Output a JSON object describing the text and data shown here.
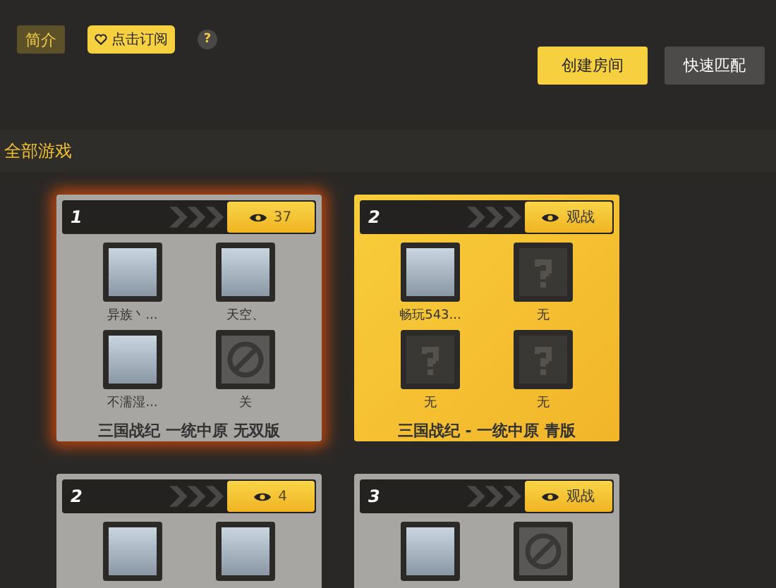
{
  "toolbar": {
    "intro_button": "简介",
    "subscribe_button": "点击订阅",
    "help_icon": "?",
    "create_room_button": "创建房间",
    "quick_match_button": "快速匹配"
  },
  "section_title": "全部游戏",
  "rooms": [
    {
      "number": "1",
      "kind": "gray",
      "selected": true,
      "watch": {
        "kind": "count",
        "label": "37"
      },
      "title": "三国战纪 一统中原 无双版",
      "slots": [
        {
          "kind": "player",
          "label": "异族丶..."
        },
        {
          "kind": "player",
          "label": "天空、"
        },
        {
          "kind": "player",
          "label": "不濡湿..."
        },
        {
          "kind": "closed",
          "label": "关"
        }
      ]
    },
    {
      "number": "2",
      "kind": "yellow",
      "selected": false,
      "watch": {
        "kind": "text",
        "label": "观战"
      },
      "title": "三国战纪 - 一统中原 青版",
      "slots": [
        {
          "kind": "player",
          "label": "畅玩543..."
        },
        {
          "kind": "empty",
          "label": "无"
        },
        {
          "kind": "empty",
          "label": "无"
        },
        {
          "kind": "empty",
          "label": "无"
        }
      ]
    },
    {
      "number": "2",
      "kind": "gray",
      "selected": false,
      "watch": {
        "kind": "count",
        "label": "4"
      },
      "slots": [
        {
          "kind": "player"
        },
        {
          "kind": "player"
        }
      ]
    },
    {
      "number": "3",
      "kind": "gray",
      "selected": false,
      "watch": {
        "kind": "text",
        "label": "观战"
      },
      "slots": [
        {
          "kind": "player"
        },
        {
          "kind": "closed"
        }
      ]
    }
  ]
}
